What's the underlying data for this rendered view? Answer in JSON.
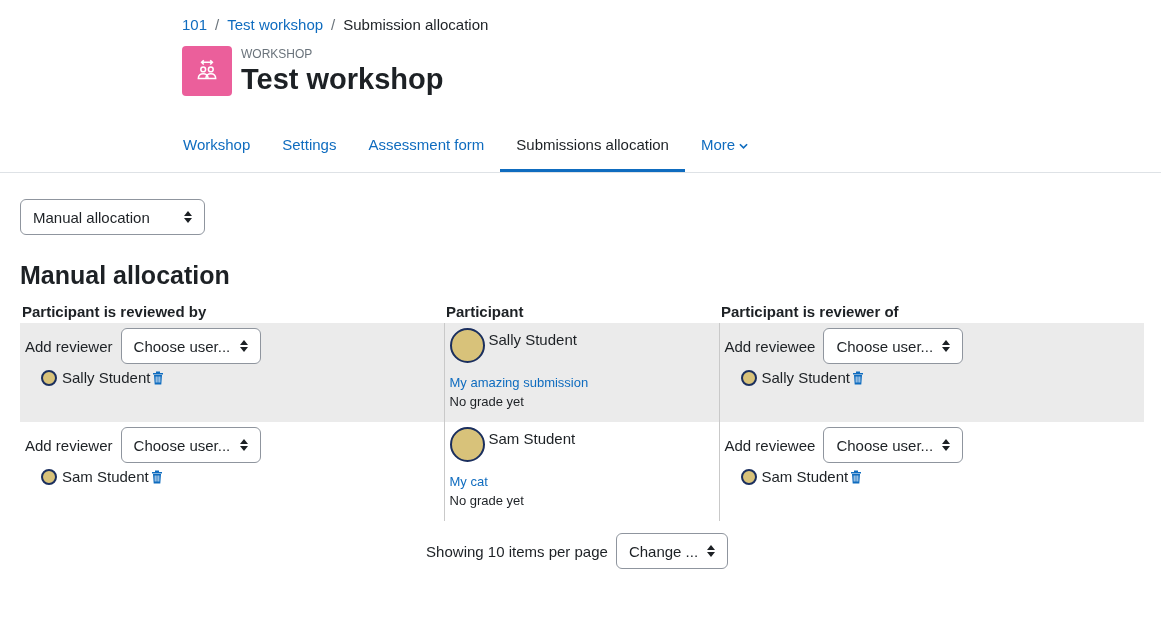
{
  "breadcrumb": [
    {
      "label": "101",
      "link": true
    },
    {
      "separator": "/",
      "label": "Test workshop",
      "link": true
    },
    {
      "separator": "/",
      "label": "Submission allocation",
      "link": false
    }
  ],
  "header": {
    "kind_label": "WORKSHOP",
    "title": "Test workshop"
  },
  "tabs": [
    {
      "label": "Workshop",
      "selected": false,
      "dropdown": false
    },
    {
      "label": "Settings",
      "selected": false,
      "dropdown": false
    },
    {
      "label": "Assessment form",
      "selected": false,
      "dropdown": false
    },
    {
      "label": "Submissions allocation",
      "selected": true,
      "dropdown": false
    },
    {
      "label": "More",
      "selected": false,
      "dropdown": true
    }
  ],
  "method_select": {
    "value": "Manual allocation"
  },
  "heading": "Manual allocation",
  "table": {
    "columns": [
      "Participant is reviewed by",
      "Participant",
      "Participant is reviewer of"
    ],
    "rows": [
      {
        "highlighted": true,
        "reviewer_label": "Add reviewer",
        "reviewer_select": "Choose user...",
        "reviewers": [
          "Sally Student"
        ],
        "participant": "Sally Student",
        "submission": "My amazing submission",
        "grade": "No grade yet",
        "reviewee_label": "Add reviewee",
        "reviewee_select": "Choose user...",
        "reviewees": [
          "Sally Student"
        ]
      },
      {
        "highlighted": false,
        "reviewer_label": "Add reviewer",
        "reviewer_select": "Choose user...",
        "reviewers": [
          "Sam Student"
        ],
        "participant": "Sam Student",
        "submission": "My cat",
        "grade": "No grade yet",
        "reviewee_label": "Add reviewee",
        "reviewee_select": "Choose user...",
        "reviewees": [
          "Sam Student"
        ]
      }
    ]
  },
  "paging": {
    "text": "Showing 10 items per page",
    "select": "Change ..."
  }
}
